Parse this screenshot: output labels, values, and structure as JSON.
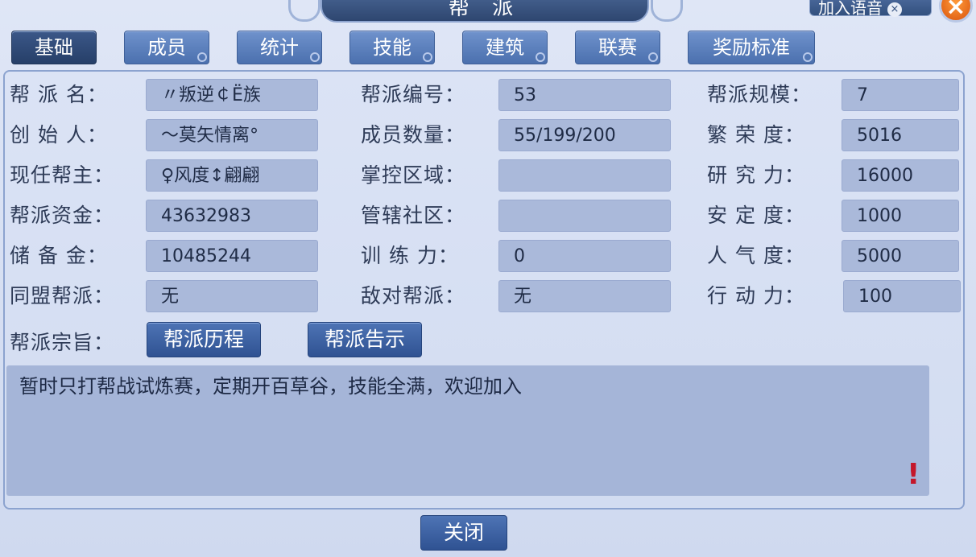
{
  "window": {
    "title": "帮 派",
    "voice_btn": "加入语音",
    "voice_icon": "×",
    "close_icon": "×"
  },
  "tabs": [
    "基础",
    "成员",
    "统计",
    "技能",
    "建筑",
    "联赛",
    "奖励标准"
  ],
  "fields": [
    {
      "label": "帮 派 名：",
      "value": "〃叛逆￠Ё族"
    },
    {
      "label": "帮派编号：",
      "value": "53"
    },
    {
      "label": "帮派规模：",
      "value": "7"
    },
    {
      "label": "创 始 人：",
      "value": "～莫矢情离°"
    },
    {
      "label": "成员数量：",
      "value": "55/199/200"
    },
    {
      "label": "繁 荣 度：",
      "value": "5016"
    },
    {
      "label": "现任帮主：",
      "value": "♀风度↕翩翩"
    },
    {
      "label": "掌控区域：",
      "value": ""
    },
    {
      "label": "研 究 力：",
      "value": "16000"
    },
    {
      "label": "帮派资金：",
      "value": "43632983"
    },
    {
      "label": "管辖社区：",
      "value": ""
    },
    {
      "label": "安 定 度：",
      "value": "1000"
    },
    {
      "label": "储 备 金：",
      "value": "10485244"
    },
    {
      "label": "训 练 力：",
      "value": "0"
    },
    {
      "label": "人 气 度：",
      "value": "5000"
    },
    {
      "label": "同盟帮派：",
      "value": "无"
    },
    {
      "label": "敌对帮派：",
      "value": "无"
    },
    {
      "label": "行 动 力：",
      "value": "100"
    }
  ],
  "motto": {
    "label": "帮派宗旨：",
    "history_btn": "帮派历程",
    "notice_btn": "帮派告示",
    "text": "暂时只打帮战试炼赛，定期开百草谷，技能全满，欢迎加入",
    "warn_icon": "!"
  },
  "close_label": "关闭"
}
